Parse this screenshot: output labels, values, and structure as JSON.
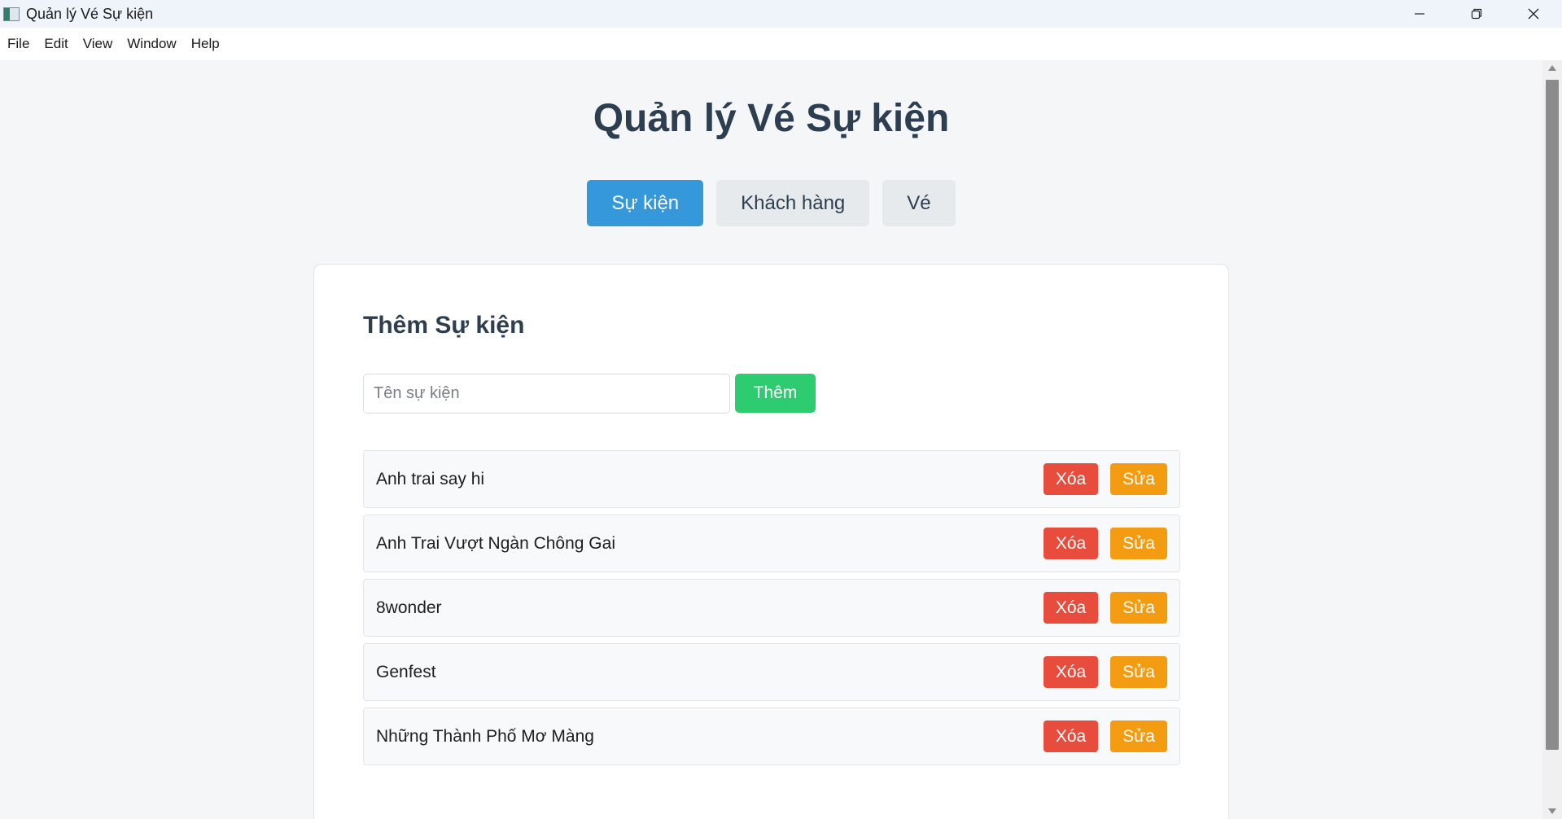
{
  "window": {
    "title": "Quản lý Vé Sự kiện",
    "controls": [
      "minimize-icon",
      "restore-icon",
      "close-icon"
    ]
  },
  "menu": [
    "File",
    "Edit",
    "View",
    "Window",
    "Help"
  ],
  "page": {
    "title": "Quản lý Vé Sự kiện"
  },
  "tabs": [
    {
      "label": "Sự kiện",
      "active": true
    },
    {
      "label": "Khách hàng",
      "active": false
    },
    {
      "label": "Vé",
      "active": false
    }
  ],
  "card": {
    "title": "Thêm Sự kiện",
    "input_placeholder": "Tên sự kiện",
    "input_value": "",
    "add_label": "Thêm"
  },
  "events": [
    {
      "name": "Anh trai say hi",
      "delete_label": "Xóa",
      "edit_label": "Sửa"
    },
    {
      "name": "Anh Trai Vượt Ngàn Chông Gai",
      "delete_label": "Xóa",
      "edit_label": "Sửa"
    },
    {
      "name": "8wonder",
      "delete_label": "Xóa",
      "edit_label": "Sửa"
    },
    {
      "name": "Genfest",
      "delete_label": "Xóa",
      "edit_label": "Sửa"
    },
    {
      "name": "Những Thành Phố Mơ Màng",
      "delete_label": "Xóa",
      "edit_label": "Sửa"
    }
  ],
  "colors": {
    "primary": "#3498db",
    "success": "#2ecc71",
    "danger": "#e74c3c",
    "warning": "#f39c12",
    "heading": "#2c3e50"
  }
}
